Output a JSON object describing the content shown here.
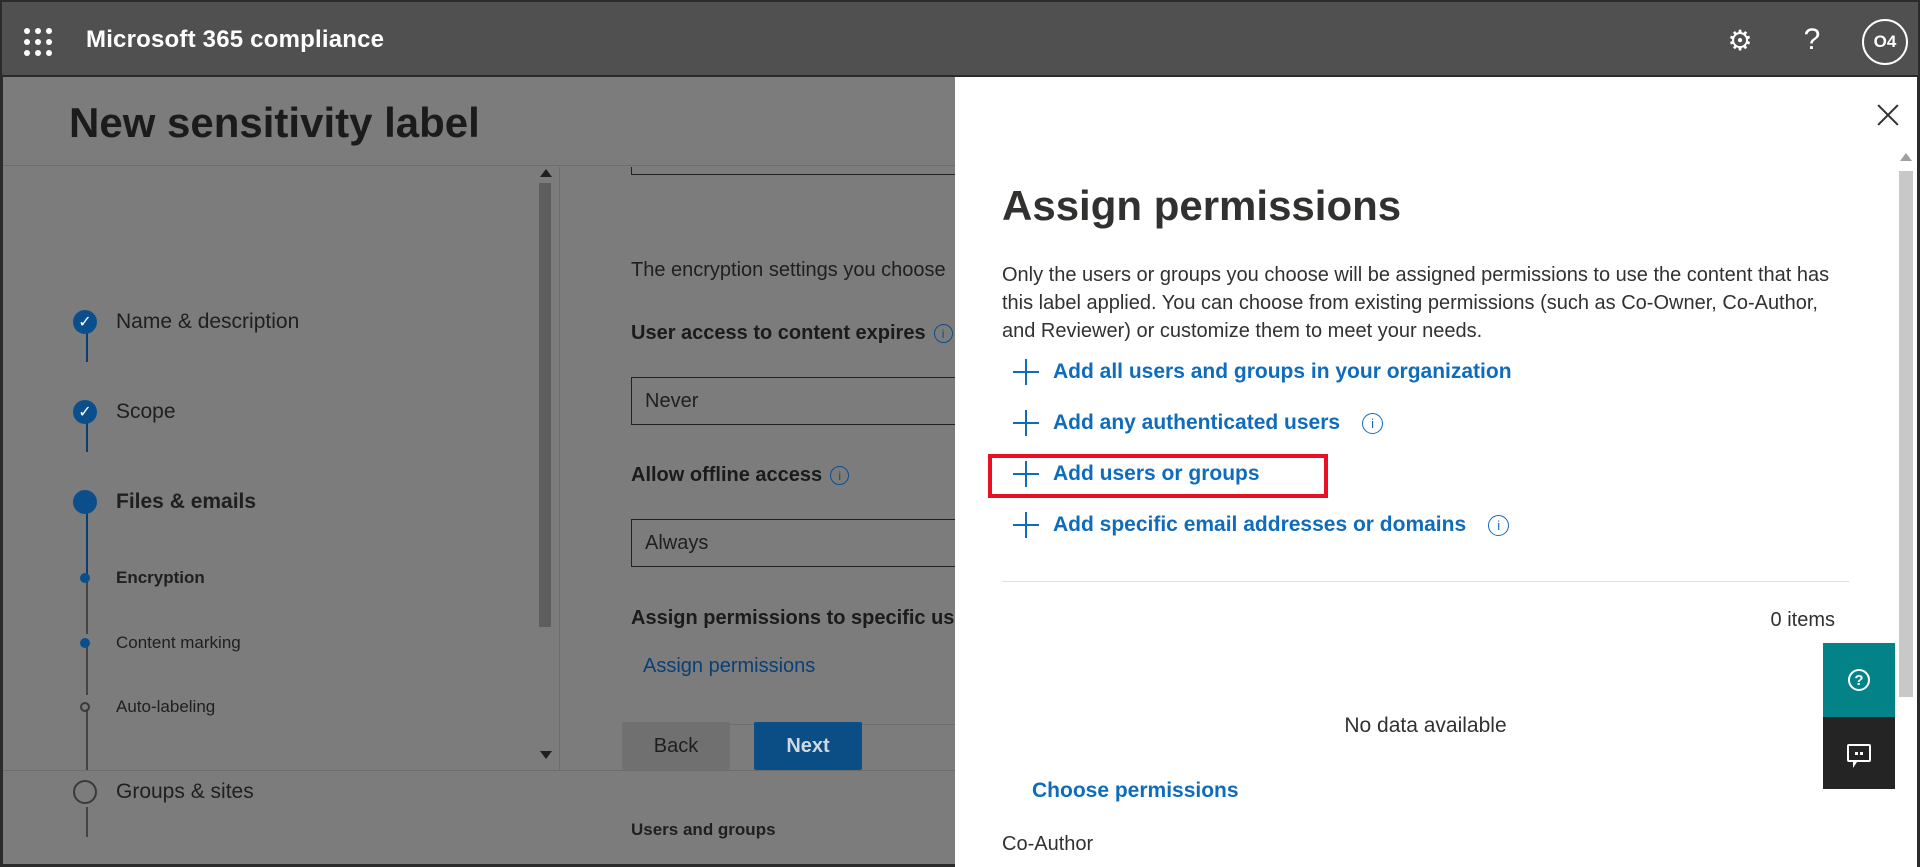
{
  "header": {
    "app_title": "Microsoft 365 compliance",
    "avatar_initials": "O4",
    "icons": [
      "app-launcher-icon",
      "gear-icon",
      "help-icon"
    ]
  },
  "page": {
    "title": "New sensitivity label",
    "steps": [
      {
        "label": "Name & description",
        "state": "completed"
      },
      {
        "label": "Scope",
        "state": "completed"
      },
      {
        "label": "Files & emails",
        "state": "current"
      },
      {
        "label": "Encryption",
        "state": "current-substep"
      },
      {
        "label": "Content marking",
        "state": "substep"
      },
      {
        "label": "Auto-labeling",
        "state": "substep-pending"
      },
      {
        "label": "Groups & sites",
        "state": "pending"
      }
    ],
    "form": {
      "encryption_note": "The encryption settings you choose",
      "expires_label": "User access to content expires",
      "expires_value": "Never",
      "offline_label": "Allow offline access",
      "offline_value": "Always",
      "assign_label": "Assign permissions to specific use",
      "assign_link": "Assign permissions",
      "users_groups": "Users and groups"
    },
    "buttons": {
      "back": "Back",
      "next": "Next"
    }
  },
  "panel": {
    "title": "Assign permissions",
    "description": "Only the users or groups you choose will be assigned permissions to use the content that has this label applied. You can choose from existing permissions (such as Co-Owner, Co-Author, and Reviewer) or customize them to meet your needs.",
    "actions": [
      {
        "label": "Add all users and groups in your organization",
        "info": false
      },
      {
        "label": "Add any authenticated users",
        "info": true
      },
      {
        "label": "Add users or groups",
        "info": false,
        "highlighted": true
      },
      {
        "label": "Add specific email addresses or domains",
        "info": true
      }
    ],
    "items_count": "0 items",
    "no_data": "No data available",
    "choose_permissions": "Choose permissions",
    "permission_name": "Co-Author"
  },
  "floating": {
    "help_icon": "help-circle-icon",
    "feedback_icon": "feedback-icon"
  },
  "colors": {
    "topbar": "#505050",
    "accent": "#0f6cbd",
    "highlight": "#e81123",
    "help_fab": "#038387"
  }
}
